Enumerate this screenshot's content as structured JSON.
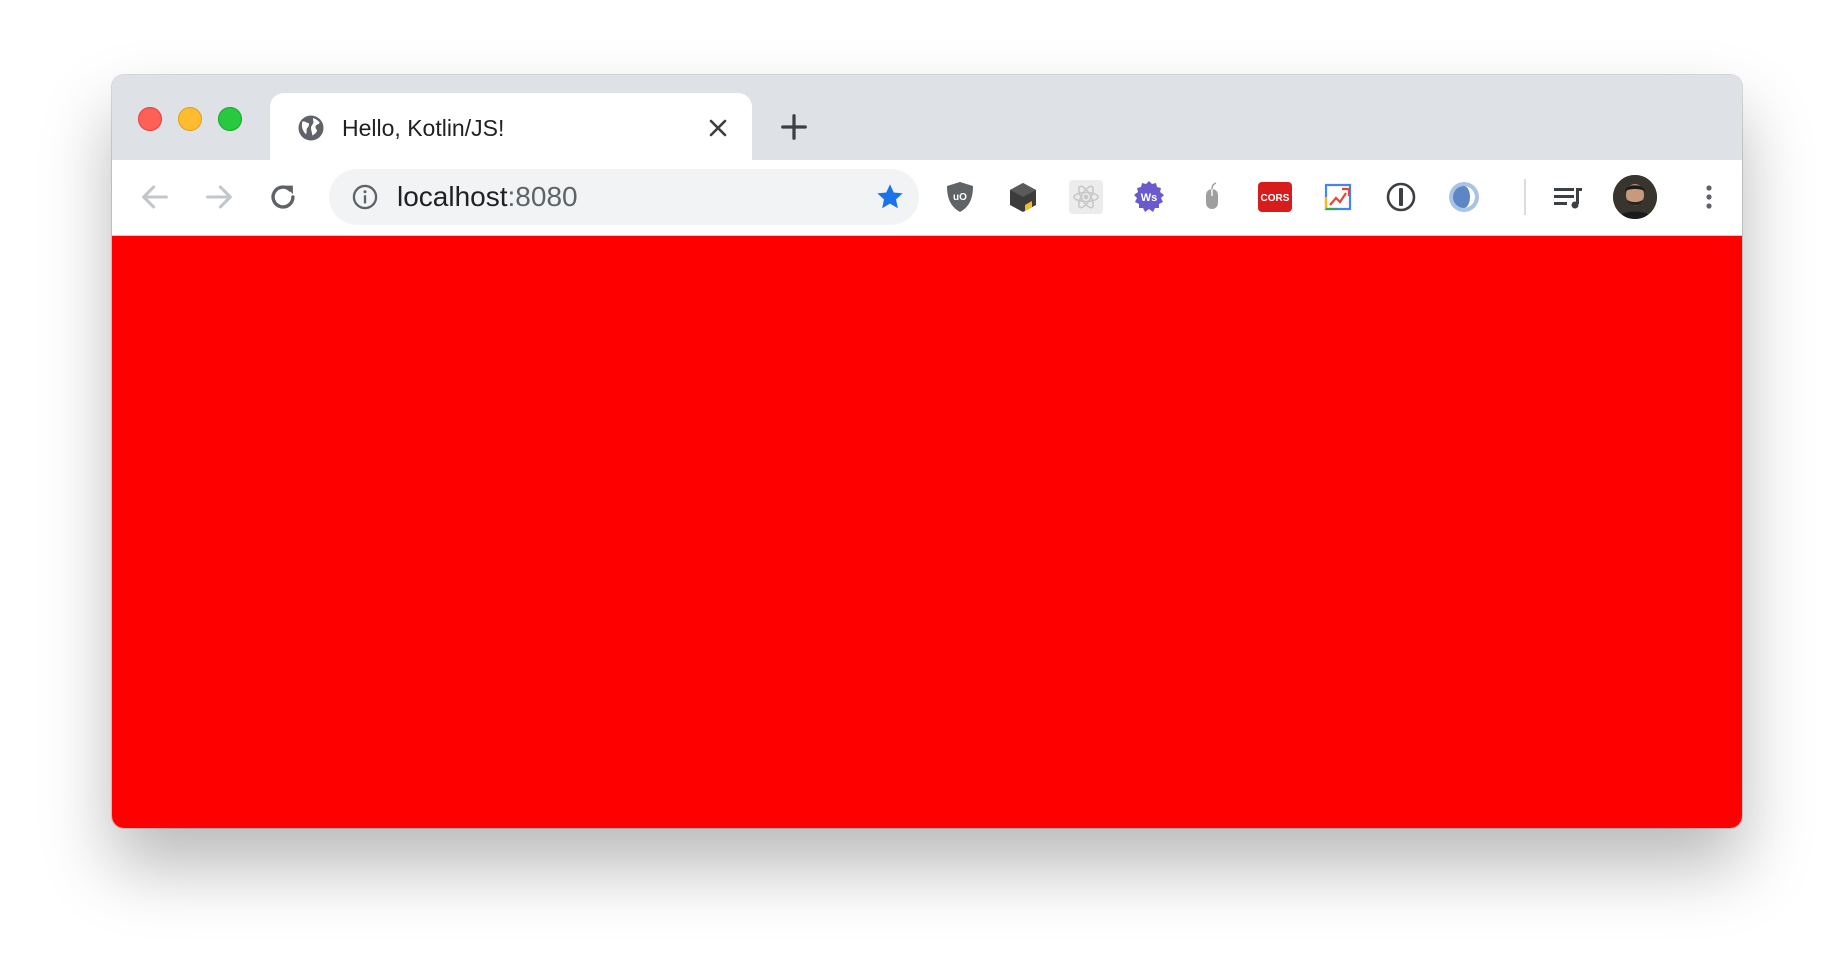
{
  "window": {
    "traffic_lights": [
      "close",
      "minimize",
      "maximize"
    ]
  },
  "tabs": [
    {
      "title": "Hello, Kotlin/JS!",
      "favicon": "globe-icon",
      "active": true
    }
  ],
  "address_bar": {
    "host": "localhost",
    "port": ":8080",
    "info_icon": "info-icon",
    "bookmarked": true
  },
  "extensions": [
    "ublock-origin-icon",
    "box-extension-icon",
    "react-devtools-icon",
    "websocket-extension-icon",
    "mouse-extension-icon",
    "cors-extension-icon",
    "image-extension-icon",
    "onepassword-icon",
    "circle-extension-icon"
  ],
  "extension_labels": {
    "cors": "CORS",
    "ws": "Ws",
    "ublock": "uO"
  },
  "colors": {
    "page_background": "#ff0000",
    "tabstrip": "#dee1e6",
    "star": "#1a73e8"
  }
}
